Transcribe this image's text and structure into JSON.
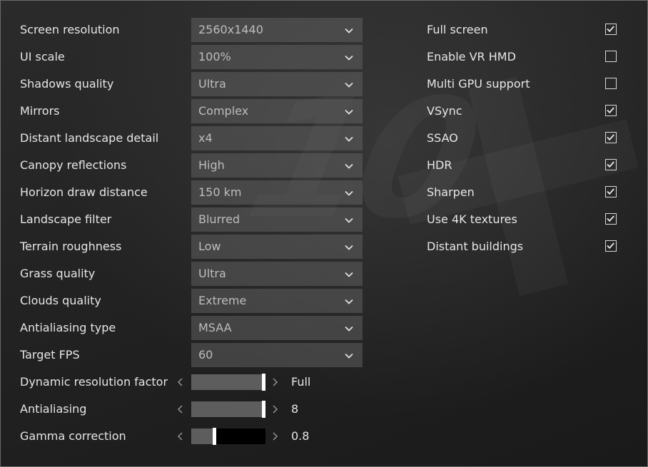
{
  "selects": [
    {
      "label": "Screen resolution",
      "value": "2560x1440"
    },
    {
      "label": "UI scale",
      "value": "100%"
    },
    {
      "label": "Shadows quality",
      "value": "Ultra"
    },
    {
      "label": "Mirrors",
      "value": "Complex"
    },
    {
      "label": "Distant landscape detail",
      "value": "x4"
    },
    {
      "label": "Canopy reflections",
      "value": "High"
    },
    {
      "label": "Horizon draw distance",
      "value": "150 km"
    },
    {
      "label": "Landscape filter",
      "value": "Blurred"
    },
    {
      "label": "Terrain roughness",
      "value": "Low"
    },
    {
      "label": "Grass quality",
      "value": "Ultra"
    },
    {
      "label": "Clouds quality",
      "value": "Extreme"
    },
    {
      "label": "Antialiasing type",
      "value": "MSAA"
    },
    {
      "label": "Target FPS",
      "value": "60"
    }
  ],
  "sliders": [
    {
      "label": "Dynamic resolution factor",
      "value": "Full",
      "level": 1.0
    },
    {
      "label": "Antialiasing",
      "value": "8",
      "level": 1.0
    },
    {
      "label": "Gamma correction",
      "value": "0.8",
      "level": 0.3
    }
  ],
  "checkboxes": [
    {
      "label": "Full screen",
      "checked": true
    },
    {
      "label": "Enable VR HMD",
      "checked": false
    },
    {
      "label": "Multi GPU support",
      "checked": false
    },
    {
      "label": "VSync",
      "checked": true
    },
    {
      "label": "SSAO",
      "checked": true
    },
    {
      "label": "HDR",
      "checked": true
    },
    {
      "label": "Sharpen",
      "checked": true
    },
    {
      "label": "Use 4K textures",
      "checked": true
    },
    {
      "label": "Distant buildings",
      "checked": true
    }
  ],
  "icons": {
    "dropdown": "chevron-down-icon",
    "slider_decrease": "chevron-left-icon",
    "slider_increase": "chevron-right-icon",
    "check": "checkmark-icon"
  },
  "colors": {
    "text": "#e6e6e6",
    "dropdown_bg": "#5f5f5f",
    "slider_fill": "#5d5d5d",
    "slider_thumb": "#ffffff",
    "panel_border": "#6a6a6a"
  }
}
